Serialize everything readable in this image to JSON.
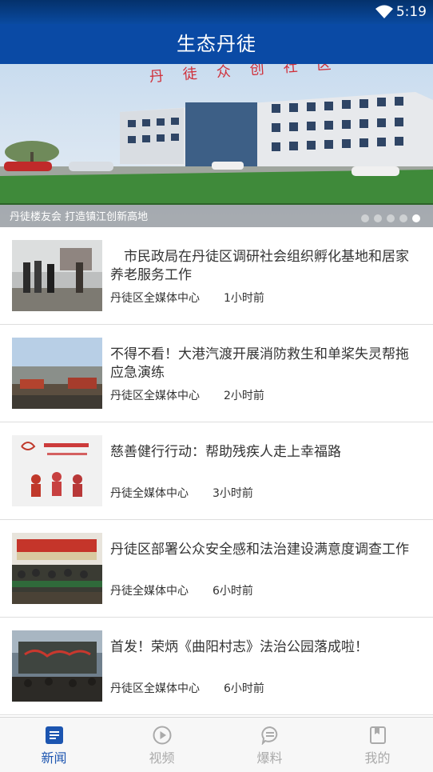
{
  "status_bar": {
    "time": "5:19"
  },
  "app_bar": {
    "title": "生态丹徒"
  },
  "banner": {
    "caption": "丹徒楼友会 打造镇江创新高地",
    "sign_text": "丹徒众创社区",
    "slide_count": 5,
    "active_index": 4
  },
  "news": [
    {
      "title": "　市民政局在丹徒区调研社会组织孵化基地和居家养老服务工作",
      "source": "丹徒区全媒体中心",
      "time": "1小时前"
    },
    {
      "title": "不得不看！大港汽渡开展消防救生和单桨失灵帮拖应急演练",
      "source": "丹徒区全媒体中心",
      "time": "2小时前"
    },
    {
      "title": "慈善健行行动：帮助残疾人走上幸福路",
      "source": "丹徒全媒体中心",
      "time": "3小时前"
    },
    {
      "title": "丹徒区部署公众安全感和法治建设满意度调查工作",
      "source": "丹徒全媒体中心",
      "time": "6小时前"
    },
    {
      "title": "首发！荣炳《曲阳村志》法治公园落成啦！",
      "source": "丹徒区全媒体中心",
      "time": "6小时前"
    }
  ],
  "bottom_nav": [
    {
      "label": "新闻",
      "icon": "news-icon",
      "active": true
    },
    {
      "label": "视频",
      "icon": "play-icon",
      "active": false
    },
    {
      "label": "爆料",
      "icon": "chat-icon",
      "active": false
    },
    {
      "label": "我的",
      "icon": "bookmark-icon",
      "active": false
    }
  ],
  "colors": {
    "primary": "#0a4aa5",
    "active_tab": "#1c55b0",
    "inactive_tab": "#aaaaaa"
  }
}
